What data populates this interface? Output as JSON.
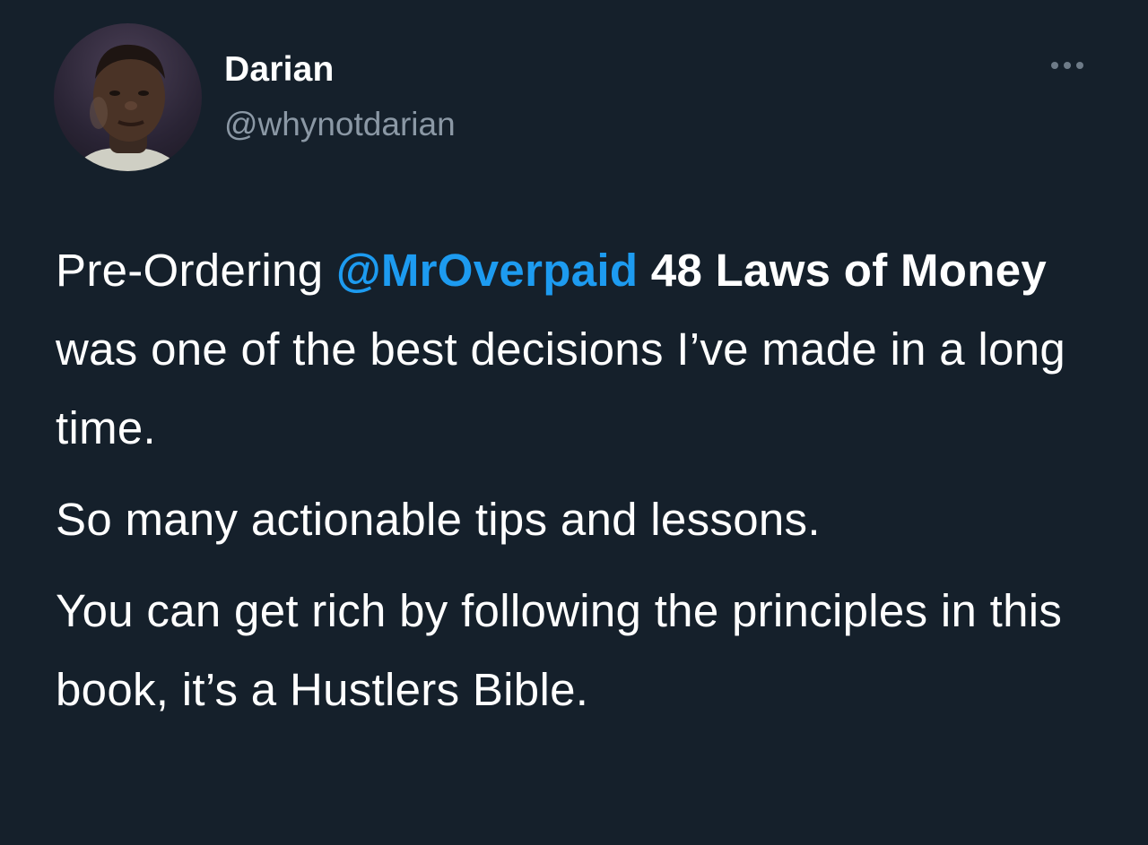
{
  "user": {
    "display_name": "Darian",
    "handle": "@whynotdarian"
  },
  "menu": {
    "icon": "more-horizontal-icon"
  },
  "tweet": {
    "p1_a": "Pre-Ordering ",
    "p1_mention": "@MrOverpaid",
    "p1_space": " ",
    "p1_bold": "48 Laws of Money",
    "p1_rest": " was one of the best decisions I’ve made in a long time.",
    "p2": "So many actionable tips and lessons.",
    "p3": "You can get rich by following the principles in this book, it’s a Hustlers Bible."
  },
  "colors": {
    "background": "#15202b",
    "mention": "#1d9bf0",
    "handle": "#8b98a5",
    "text": "#ffffff"
  }
}
